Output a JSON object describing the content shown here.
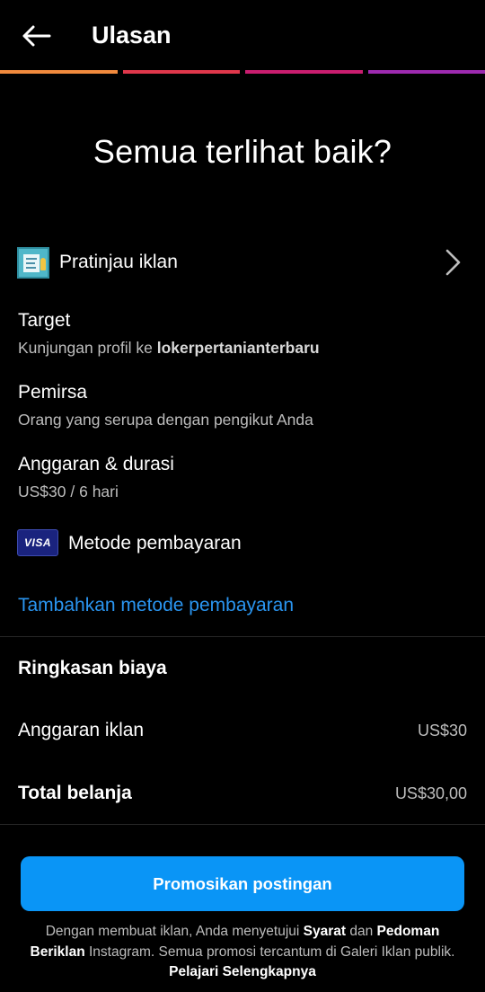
{
  "header": {
    "title": "Ulasan",
    "progress_colors": [
      "#f18a3d",
      "#e0374b",
      "#c91d6f",
      "#9d2ab0"
    ]
  },
  "heading": "Semua terlihat baik?",
  "preview": {
    "label": "Pratinjau iklan"
  },
  "target": {
    "label": "Target",
    "value_prefix": "Kunjungan profil ke ",
    "value_handle": "lokerpertanianterbaru"
  },
  "audience": {
    "label": "Pemirsa",
    "value": "Orang yang serupa dengan pengikut Anda"
  },
  "budget": {
    "label": "Anggaran & durasi",
    "value": "US$30 / 6 hari"
  },
  "payment": {
    "card_brand": "VISA",
    "label": "Metode pembayaran",
    "add_link": "Tambahkan metode pembayaran"
  },
  "summary": {
    "title": "Ringkasan biaya",
    "ad_budget_label": "Anggaran iklan",
    "ad_budget_value": "US$30",
    "total_label": "Total belanja",
    "total_value": "US$30,00"
  },
  "cta": {
    "label": "Promosikan postingan"
  },
  "legal": {
    "t1": "Dengan membuat iklan, Anda menyetujui ",
    "link_terms": "Syarat",
    "t2": " dan ",
    "link_guidelines": "Pedoman Beriklan",
    "t3": " Instagram. Semua promosi tercantum di Galeri Iklan publik. ",
    "link_learn": "Pelajari Selengkapnya"
  }
}
